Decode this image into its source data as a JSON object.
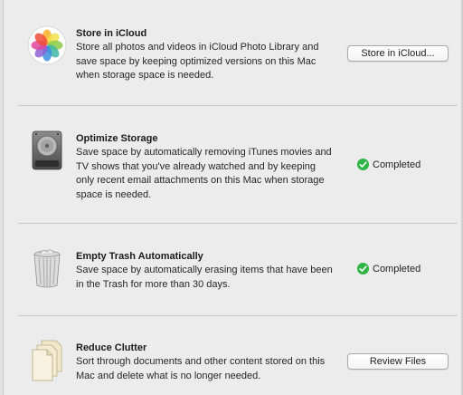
{
  "sections": [
    {
      "title": "Store in iCloud",
      "description": "Store all photos and videos in iCloud Photo Library and save space by keeping optimized versions on this Mac when storage space is needed.",
      "icon": "photos-icon",
      "action_label": "Store in iCloud..."
    },
    {
      "title": "Optimize Storage",
      "description": "Save space by automatically removing iTunes movies and TV shows that you've already watched and by keeping only recent email attachments on this Mac when storage space is needed.",
      "icon": "hard-drive-icon",
      "status_label": "Completed"
    },
    {
      "title": "Empty Trash Automatically",
      "description": "Save space by automatically erasing items that have been in the Trash for more than 30 days.",
      "icon": "trash-icon",
      "status_label": "Completed"
    },
    {
      "title": "Reduce Clutter",
      "description": "Sort through documents and other content stored on this Mac and delete what is no longer needed.",
      "icon": "documents-icon",
      "action_label": "Review Files"
    }
  ],
  "colors": {
    "background": "#ececec",
    "divider": "#cbcbcb",
    "status_check": "#2fb546"
  }
}
